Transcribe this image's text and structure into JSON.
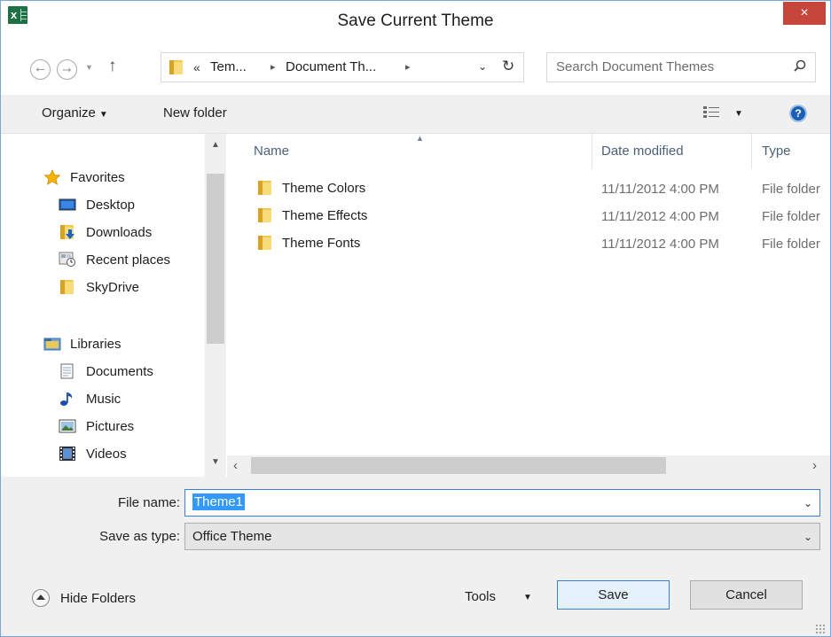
{
  "window": {
    "title": "Save Current Theme",
    "close_glyph": "×",
    "app_icon_letter": "x"
  },
  "navigation": {
    "back_glyph": "⭠",
    "forward_glyph": "⭢",
    "history_glyph": "▼",
    "up_glyph": "↑",
    "address_overflow": "«",
    "crumbs": [
      "Tem...",
      "Document Th..."
    ],
    "crumb_separator": "▸",
    "dropdown_glyph": "⌄",
    "refresh_glyph": "↻",
    "search_placeholder": "Search Document Themes"
  },
  "toolbar": {
    "organize_label": "Organize",
    "organize_caret": "▼",
    "new_folder_label": "New folder",
    "view_caret": "▼",
    "help_glyph": "?"
  },
  "nav_pane": {
    "favorites": {
      "label": "Favorites",
      "items": [
        {
          "label": "Desktop",
          "icon": "desktop-icon"
        },
        {
          "label": "Downloads",
          "icon": "downloads-icon"
        },
        {
          "label": "Recent places",
          "icon": "recent-places-icon"
        },
        {
          "label": "SkyDrive",
          "icon": "skydrive-icon"
        }
      ]
    },
    "libraries": {
      "label": "Libraries",
      "items": [
        {
          "label": "Documents",
          "icon": "documents-icon"
        },
        {
          "label": "Music",
          "icon": "music-icon"
        },
        {
          "label": "Pictures",
          "icon": "pictures-icon"
        },
        {
          "label": "Videos",
          "icon": "videos-icon"
        }
      ]
    },
    "scroll_up": "▲",
    "scroll_down": "▼"
  },
  "file_list": {
    "columns": {
      "name": "Name",
      "date": "Date modified",
      "type": "Type"
    },
    "sort_glyph": "▲",
    "rows": [
      {
        "name": "Theme Colors",
        "date": "11/11/2012 4:00 PM",
        "type": "File folder"
      },
      {
        "name": "Theme Effects",
        "date": "11/11/2012 4:00 PM",
        "type": "File folder"
      },
      {
        "name": "Theme Fonts",
        "date": "11/11/2012 4:00 PM",
        "type": "File folder"
      }
    ],
    "scroll_left": "‹",
    "scroll_right": "›"
  },
  "form": {
    "file_name_label": "File name:",
    "file_name_value": "Theme1",
    "save_as_type_label": "Save as type:",
    "save_as_type_value": "Office Theme",
    "dropdown_glyph": "⌄"
  },
  "footer": {
    "hide_folders_label": "Hide Folders",
    "tools_label": "Tools",
    "tools_caret": "▼",
    "save_label": "Save",
    "cancel_label": "Cancel"
  },
  "colors": {
    "accent": "#3c7fd0",
    "close_button": "#c7463b",
    "selection": "#3399ff",
    "excel_green": "#1d7044",
    "folder_yellow": "#f2c94c"
  }
}
